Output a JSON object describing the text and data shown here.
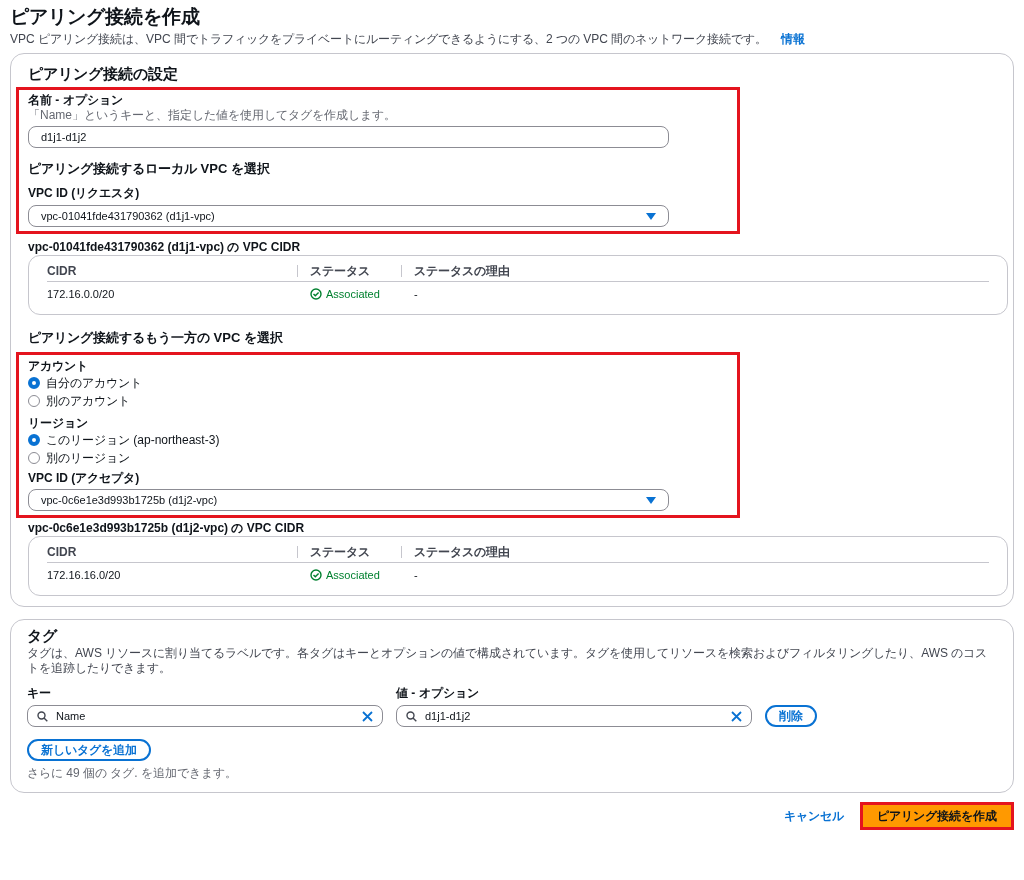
{
  "page": {
    "title": "ピアリング接続を作成",
    "description": "VPC ピアリング接続は、VPC 間でトラフィックをプライベートにルーティングできるようにする、2 つの VPC 間のネットワーク接続です。",
    "info_link": "情報"
  },
  "settings": {
    "title": "ピアリング接続の設定",
    "name_field": {
      "label": "名前 - オプション",
      "hint": "「Name」というキーと、指定した値を使用してタグを作成します。",
      "value": "d1j1-d1j2"
    },
    "local": {
      "title": "ピアリング接続するローカル VPC を選択",
      "vpc_label": "VPC ID (リクエスタ)",
      "vpc_value": "vpc-01041fde431790362 (d1j1-vpc)"
    },
    "local_cidr": {
      "title": "vpc-01041fde431790362 (d1j1-vpc) の VPC CIDR",
      "columns": [
        "CIDR",
        "ステータス",
        "ステータスの理由"
      ],
      "rows": [
        {
          "cidr": "172.16.0.0/20",
          "status": "Associated",
          "reason": "-"
        }
      ]
    },
    "peer": {
      "title": "ピアリング接続するもう一方の VPC を選択",
      "groups": [
        {
          "label": "アカウント",
          "options": [
            {
              "label": "自分のアカウント",
              "selected": true
            },
            {
              "label": "別のアカウント",
              "selected": false
            }
          ]
        },
        {
          "label": "リージョン",
          "options": [
            {
              "label": "このリージョン (ap-northeast-3)",
              "selected": true
            },
            {
              "label": "別のリージョン",
              "selected": false
            }
          ]
        }
      ],
      "vpc_label": "VPC ID (アクセプタ)",
      "vpc_value": "vpc-0c6e1e3d993b1725b (d1j2-vpc)"
    },
    "peer_cidr": {
      "title": "vpc-0c6e1e3d993b1725b (d1j2-vpc) の VPC CIDR",
      "columns": [
        "CIDR",
        "ステータス",
        "ステータスの理由"
      ],
      "rows": [
        {
          "cidr": "172.16.16.0/20",
          "status": "Associated",
          "reason": "-"
        }
      ]
    }
  },
  "tags": {
    "title": "タグ",
    "description": "タグは、AWS リソースに割り当てるラベルです。各タグはキーとオプションの値で構成されています。タグを使用してリソースを検索およびフィルタリングしたり、AWS のコストを追跡したりできます。",
    "key_label": "キー",
    "value_label": "値 - オプション",
    "rows": [
      {
        "key": "Name",
        "value": "d1j1-d1j2",
        "remove": "削除"
      }
    ],
    "add_button": "新しいタグを追加",
    "limit_note": "さらに 49 個の タグ. を追加できます。"
  },
  "footer": {
    "cancel": "キャンセル",
    "submit": "ピアリング接続を作成"
  }
}
